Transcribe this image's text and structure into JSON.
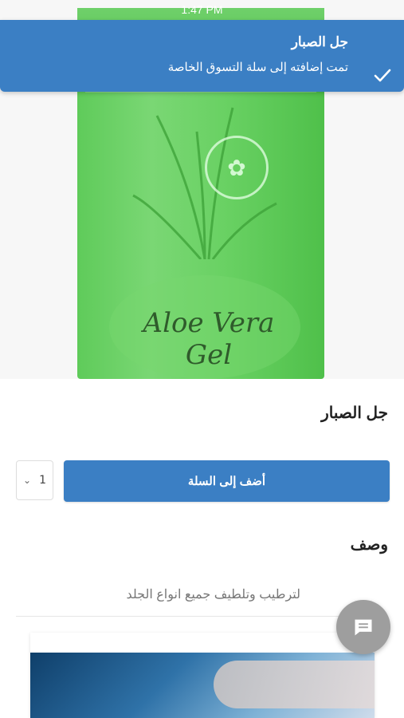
{
  "status_bar": {
    "time": "1:47 PM"
  },
  "notification": {
    "title": "جل الصبار",
    "message": "تمت إضافته إلى سلة التسوق الخاصة",
    "icon": "check-icon"
  },
  "product": {
    "image_text": "Aloe Vera Gel",
    "title": "جل الصبار",
    "quantity": "1",
    "add_to_cart_label": "أضف إلى السلة"
  },
  "description": {
    "heading": "وصف",
    "text": "لترطيب وتلطيف جميع انواع الجلد"
  },
  "chat": {
    "icon": "chat-icon"
  },
  "colors": {
    "accent": "#3b7fc4",
    "chat_button": "#9e9e9e"
  }
}
